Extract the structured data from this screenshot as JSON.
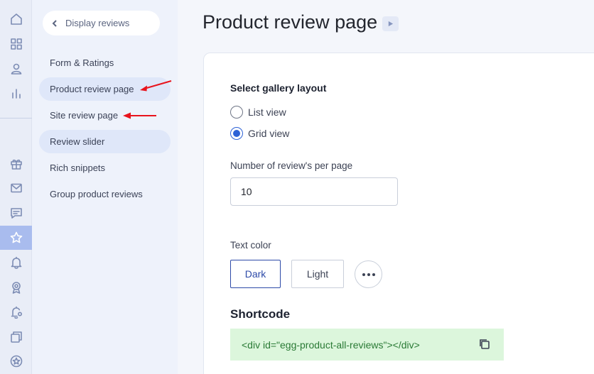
{
  "sidebar": {
    "rail_icons": [
      "home-icon",
      "apps-grid-icon",
      "user-icon",
      "bar-chart-icon",
      "gift-icon",
      "mail-icon",
      "chat-icon",
      "star-icon",
      "bell-icon",
      "award-icon",
      "bell-settings-icon",
      "copy-stack-icon",
      "star-badge-icon"
    ],
    "active_icon": "star-icon"
  },
  "subnav": {
    "back_label": "Display reviews",
    "items": [
      {
        "label": "Form & Ratings",
        "active": false
      },
      {
        "label": "Product review page",
        "active": true
      },
      {
        "label": "Site review page",
        "active": false
      },
      {
        "label": "Review slider",
        "active": true
      },
      {
        "label": "Rich snippets",
        "active": false
      },
      {
        "label": "Group product reviews",
        "active": false
      }
    ],
    "annotation_color": "#e8131c"
  },
  "page": {
    "title": "Product review page"
  },
  "form": {
    "gallery": {
      "title": "Select gallery layout",
      "options": [
        {
          "label": "List view",
          "checked": false
        },
        {
          "label": "Grid view",
          "checked": true
        }
      ]
    },
    "per_page": {
      "label": "Number of review's per page",
      "value": "10"
    },
    "text_color": {
      "label": "Text color",
      "options": [
        {
          "label": "Dark",
          "selected": true
        },
        {
          "label": "Light",
          "selected": false
        }
      ]
    },
    "shortcode": {
      "title": "Shortcode",
      "code": "<div id=\"egg-product-all-reviews\"></div>"
    }
  },
  "colors": {
    "accent": "#2d62d6",
    "shortcode_bg": "#dcf6dc",
    "shortcode_text": "#2a7a35",
    "active_rail": "#a9bcee"
  }
}
